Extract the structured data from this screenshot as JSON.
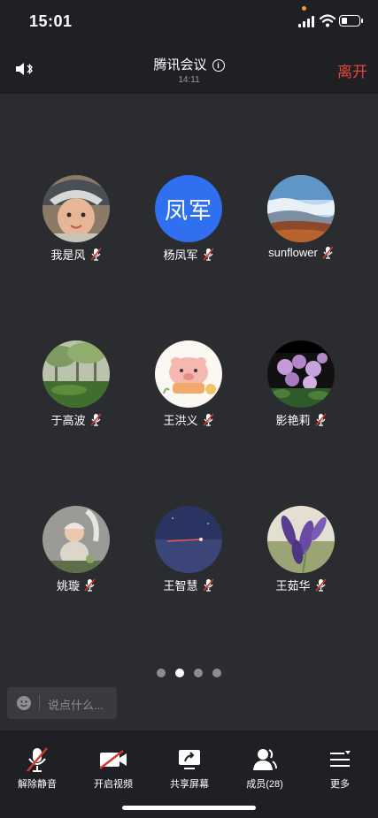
{
  "status": {
    "time": "15:01"
  },
  "header": {
    "title": "腾讯会议",
    "duration": "14:11",
    "leave": "离开"
  },
  "members": [
    {
      "name": "我是风",
      "avatar": "photo-child"
    },
    {
      "name": "杨凤军",
      "avatar": "text",
      "avatar_text": "凤军",
      "avatar_color": "#2f6ff0"
    },
    {
      "name": "sunflower",
      "avatar": "photo-landscape"
    },
    {
      "name": "于高波",
      "avatar": "photo-trees"
    },
    {
      "name": "王洪义",
      "avatar": "photo-cartoon-pig"
    },
    {
      "name": "影艳莉",
      "avatar": "photo-flowers"
    },
    {
      "name": "姚璇",
      "avatar": "photo-baby"
    },
    {
      "name": "王智慧",
      "avatar": "photo-night-sky"
    },
    {
      "name": "王茹华",
      "avatar": "photo-lavender"
    }
  ],
  "pager": {
    "count": 4,
    "active": 1
  },
  "chat": {
    "placeholder": "说点什么..."
  },
  "toolbar": {
    "unmute": "解除静音",
    "video": "开启视频",
    "share": "共享屏幕",
    "members": "成员(28)",
    "more": "更多"
  },
  "colors": {
    "accent_red": "#e2453c",
    "mute_red": "#d9342b",
    "bg": "#2b2c2f",
    "bar": "#1f2023"
  }
}
